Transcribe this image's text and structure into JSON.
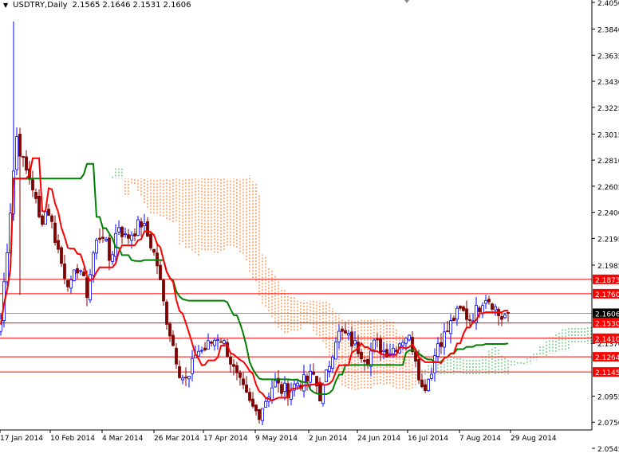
{
  "header": {
    "symbol": "USDTRY,Daily",
    "open": "2.1565",
    "high": "2.1646",
    "low": "2.1531",
    "close": "2.1606"
  },
  "chart_data": {
    "type": "candlestick",
    "title": "USDTRY,Daily",
    "ylim": [
      2.0545,
      2.405
    ],
    "y_ticks": [
      "2.4050",
      "2.3840",
      "2.3635",
      "2.3430",
      "2.3225",
      "2.3015",
      "2.2810",
      "2.2605",
      "2.2400",
      "2.2195",
      "2.1985",
      "2.1370",
      "2.0955",
      "2.0750",
      "2.0545"
    ],
    "x_ticks": [
      "17 Jan 2014",
      "10 Feb 2014",
      "4 Mar 2014",
      "26 Mar 2014",
      "17 Apr 2014",
      "9 May 2014",
      "2 Jun 2014",
      "24 Jun 2014",
      "16 Jul 2014",
      "7 Aug 2014",
      "29 Aug 2014"
    ],
    "anchor_closes": [
      2.1565,
      2.2254,
      2.3005,
      2.2754,
      2.2629,
      2.2316,
      2.2441,
      2.2191,
      2.1941,
      2.1816,
      2.2003,
      2.1753,
      2.2128,
      2.2254,
      2.2003,
      2.2316,
      2.2191,
      2.2254,
      2.2316,
      2.2191,
      2.2003,
      2.1628,
      2.1377,
      2.1127,
      2.1064,
      2.1315,
      2.1315,
      2.1377,
      2.144,
      2.1315,
      2.1127,
      2.1002,
      2.0877,
      2.0814,
      2.0939,
      2.1064,
      2.1002,
      2.1002,
      2.1064,
      2.1064,
      2.1127,
      2.0939,
      2.119,
      2.144,
      2.144,
      2.1377,
      2.1315,
      2.1252,
      2.1377,
      2.1315,
      2.1315,
      2.1377,
      2.144,
      2.1315,
      2.1002,
      2.1127,
      2.1377,
      2.144,
      2.1565,
      2.1628,
      2.1565,
      2.1628,
      2.1753,
      2.1691,
      2.1565,
      2.1606
    ],
    "level_lines": [
      {
        "value": "2.1873",
        "color": "#ff0000"
      },
      {
        "value": "2.1760",
        "color": "#ff0000"
      },
      {
        "value": "2.1530",
        "color": "#ff0000"
      },
      {
        "value": "2.1410",
        "color": "#ff0000"
      },
      {
        "value": "2.1264",
        "color": "#ff0000"
      },
      {
        "value": "2.1145",
        "color": "#ff0000"
      }
    ],
    "current_price": "2.1606",
    "kijun_last": "2.1370",
    "colors": {
      "up": "#0000ff",
      "down": "#800000",
      "tenkan": "#ff0000",
      "kijun": "#008000",
      "cloud_bull": "#2db34a",
      "cloud_bear": "#ff6600"
    }
  }
}
